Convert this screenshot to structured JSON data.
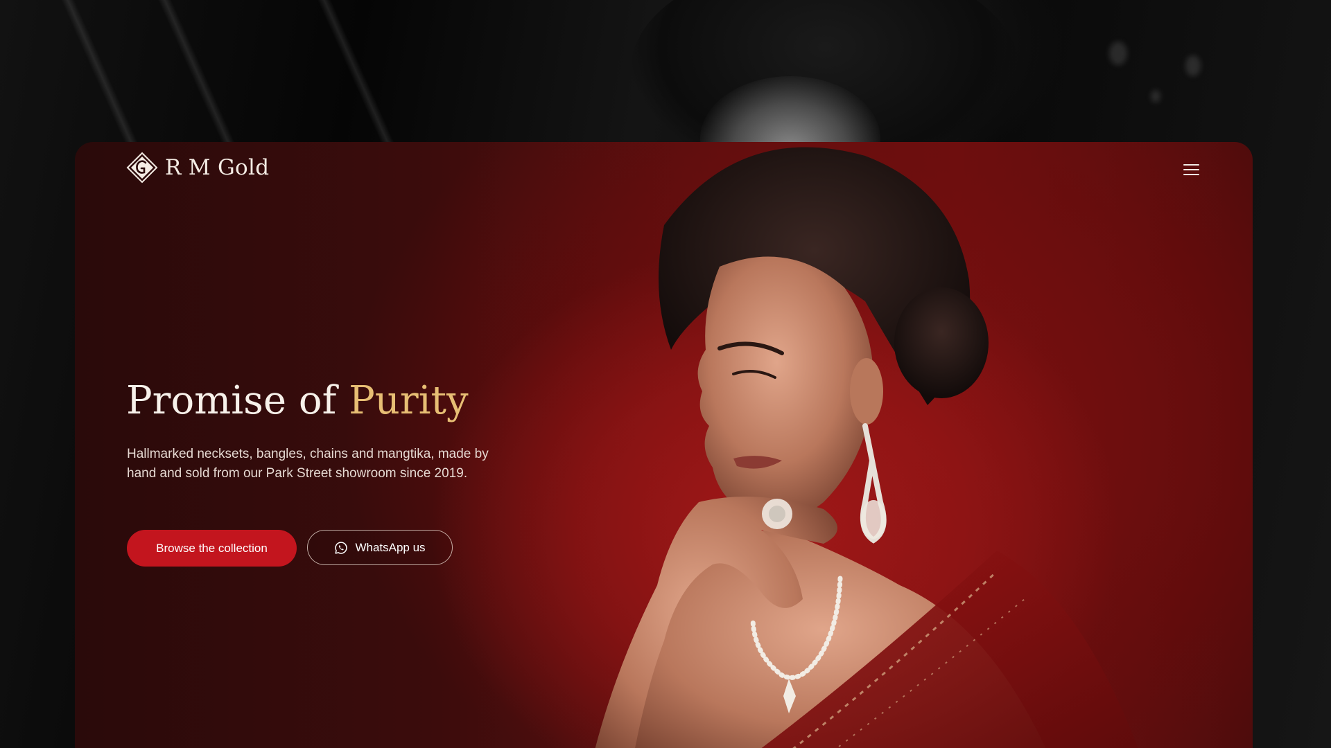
{
  "brand": {
    "name": "R M Gold",
    "logo_icon": "diamond-monogram-icon"
  },
  "nav": {
    "menu_icon": "hamburger-menu-icon"
  },
  "hero": {
    "title_main": "Promise of ",
    "title_accent": "Purity",
    "description": "Hallmarked necksets, bangles, chains and mangtika, made by hand and sold from our Park Street showroom since 2019.",
    "primary_cta": "Browse the collection",
    "secondary_cta": "WhatsApp us",
    "secondary_cta_icon": "whatsapp-icon"
  },
  "colors": {
    "accent_gold": "#e7be74",
    "primary_red": "#c3151e",
    "card_red": "#8f1515"
  }
}
